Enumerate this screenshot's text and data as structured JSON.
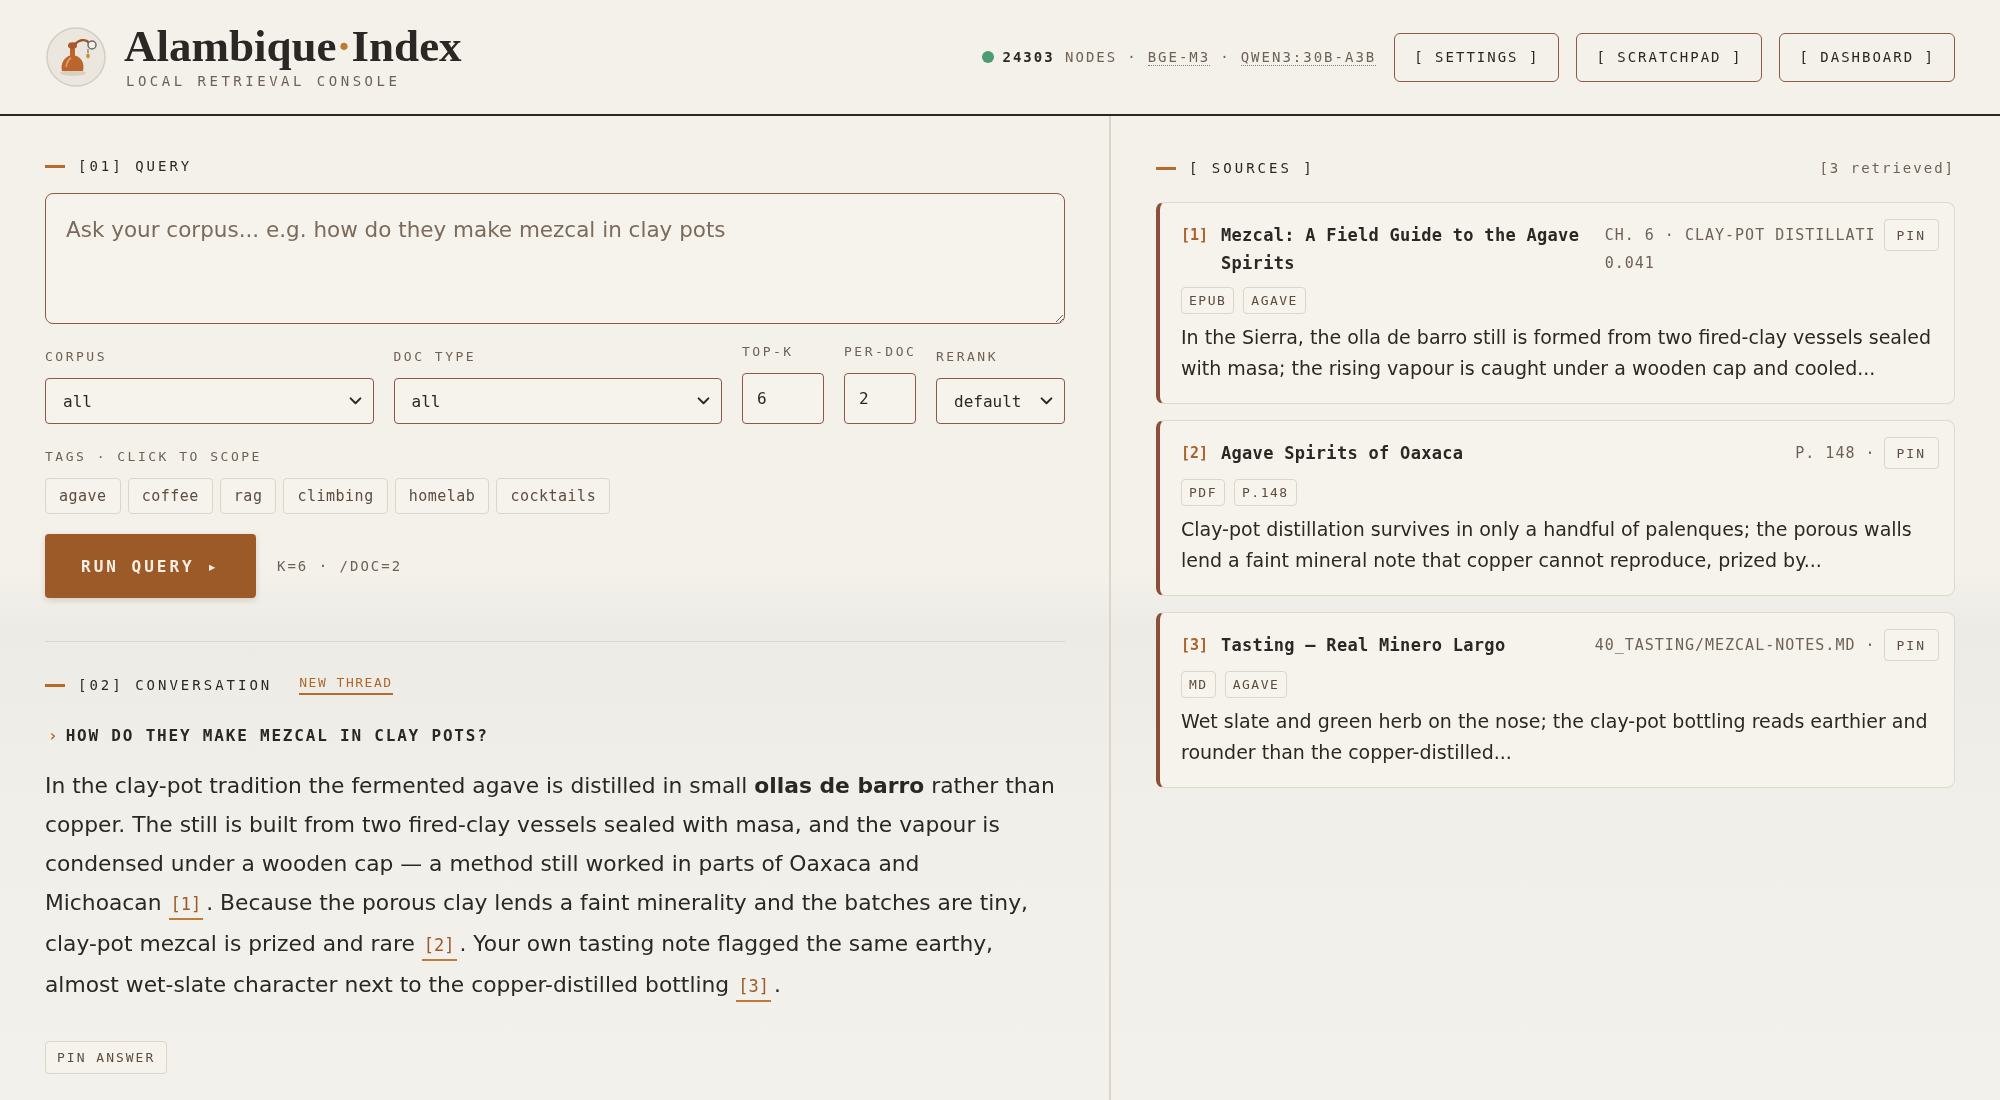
{
  "header": {
    "title": {
      "left": "Alambique",
      "dot": "·",
      "right": "Index"
    },
    "subtitle": "LOCAL RETRIEVAL CONSOLE",
    "status": {
      "online": true,
      "nodes": "**24303** NODES",
      "separator": "·",
      "models": [
        "BGE-M3",
        "QWEN3:30B-A3B"
      ]
    },
    "buttons": [
      "[ SETTINGS ]",
      "[ SCRATCHPAD ]",
      "[ DASHBOARD ]"
    ]
  },
  "query": {
    "heading": "[01] QUERY",
    "input": {
      "placeholder": "Ask your corpus... e.g. how do they make mezcal in clay pots"
    },
    "fields": [
      {
        "kind": "select",
        "label": "CORPUS",
        "value": "all"
      },
      {
        "kind": "select",
        "label": "DOC TYPE",
        "value": "all"
      },
      {
        "kind": "number",
        "label": "TOP-K",
        "value": "6"
      },
      {
        "kind": "number",
        "label": "PER-DOC",
        "value": "2"
      },
      {
        "kind": "select",
        "label": "RERANK",
        "value": "default"
      }
    ],
    "tags_label": "TAGS · CLICK TO SCOPE",
    "tags": [
      {
        "label": "agave",
        "selected": false
      },
      {
        "label": "coffee",
        "selected": false
      },
      {
        "label": "rag",
        "selected": false
      },
      {
        "label": "climbing",
        "selected": false
      },
      {
        "label": "homelab",
        "selected": false
      },
      {
        "label": "cocktails",
        "selected": false
      }
    ],
    "run_button": "RUN QUERY ▸",
    "run_summary": "K=6 · /DOC=2"
  },
  "conversation": {
    "heading": "[02] CONVERSATION",
    "new_thread": "NEW THREAD",
    "question_marker": "›",
    "question": "HOW DO THEY MAKE MEZCAL IN CLAY POTS?",
    "answer": [
      {
        "kind": "text",
        "text": "In the clay-pot tradition the fermented agave is distilled in small **ollas de barro** rather than copper. The still is built from two fired-clay vessels sealed with masa, and the vapour is condensed under a wooden cap — a method still worked in parts of Oaxaca and Michoacan"
      },
      {
        "kind": "cite",
        "text": "[1]"
      },
      {
        "kind": "text",
        "text": ". Because the porous clay lends a faint minerality and the batches are tiny, clay-pot mezcal is prized and rare"
      },
      {
        "kind": "cite",
        "text": "[2]"
      },
      {
        "kind": "text",
        "text": ". Your own tasting note flagged the same earthy, almost wet-slate character next to the copper-distilled bottling"
      },
      {
        "kind": "cite",
        "text": "[3]"
      },
      {
        "kind": "text",
        "text": "."
      }
    ],
    "pin_button": "PIN ANSWER"
  },
  "sources": {
    "heading": "[ SOURCES ]",
    "count": "[3 retrieved]",
    "items": [
      {
        "number": "[1]",
        "title": "Mezcal: A Field Guide to the Agave Spirits",
        "meta": "CH. 6 · CLAY-POT DISTILLATI",
        "score": "0.041",
        "pin": "PIN",
        "tags": [
          "EPUB",
          "AGAVE"
        ],
        "snippet": "In the Sierra, the olla de barro still is formed from two fired-clay vessels sealed with masa; the rising vapour is caught under a wooden cap and cooled..."
      },
      {
        "number": "[2]",
        "title": "Agave Spirits of Oaxaca",
        "meta": "P. 148 ·",
        "pin": "PIN",
        "tags": [
          "PDF",
          "P.148"
        ],
        "snippet": "Clay-pot distillation survives in only a handful of palenques; the porous walls lend a faint mineral note that copper cannot reproduce, prized by..."
      },
      {
        "number": "[3]",
        "title": "Tasting — Real Minero Largo",
        "meta": "40_TASTING/MEZCAL-NOTES.MD ·",
        "pin": "PIN",
        "tags": [
          "MD",
          "AGAVE"
        ],
        "snippet": "Wet slate and green herb on the nose; the clay-pot bottling reads earthier and rounder than the copper-distilled..."
      }
    ]
  }
}
